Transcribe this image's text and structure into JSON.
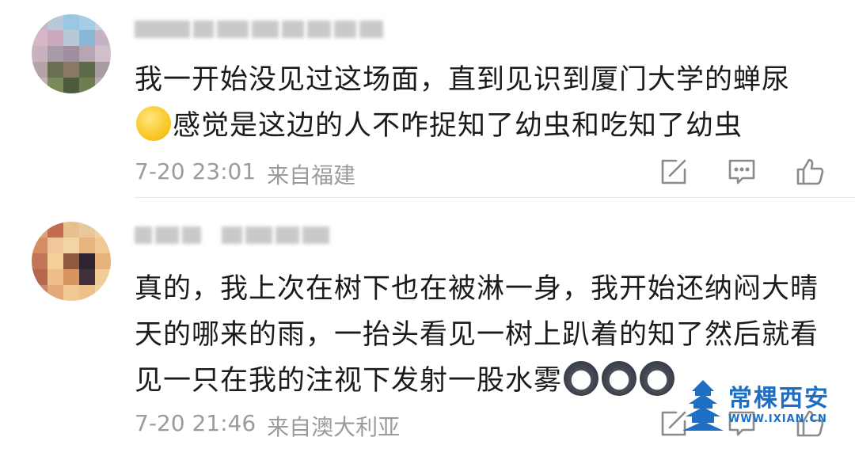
{
  "comments": [
    {
      "username": "",
      "text_line1": "我一开始没见过这场面，直到见识到厦门大学的蝉尿",
      "text_line2_emoji": "thinking-emoji",
      "text_line2": "感觉是这边的人不咋捉知了幼虫和吃知了幼虫",
      "time": "7-20 23:01",
      "location": "来自福建"
    },
    {
      "username": "",
      "text_line1": "真的，我上次在树下也在被淋一身，我开始还纳闷大晴",
      "text_line2": "天的哪来的雨，一抬头看见一树上趴着的知了然后就看",
      "text_line3": "见一只在我的注视下发射一股水雾",
      "text_line3_emoji": [
        "husky-emoji",
        "husky-emoji",
        "husky-emoji"
      ],
      "time": "7-20 21:46",
      "location": "来自澳大利亚"
    }
  ],
  "actions": {
    "share_icon": "share-icon",
    "comment_icon": "comment-icon",
    "like_icon": "like-icon"
  },
  "watermark": {
    "title": "常棵西安",
    "url": "WWW.IXIAN.CN"
  },
  "colors": {
    "text": "#1b1b1b",
    "meta": "#9b9b9b",
    "icon": "#8a8a8a",
    "brand": "#1d6fc4"
  }
}
